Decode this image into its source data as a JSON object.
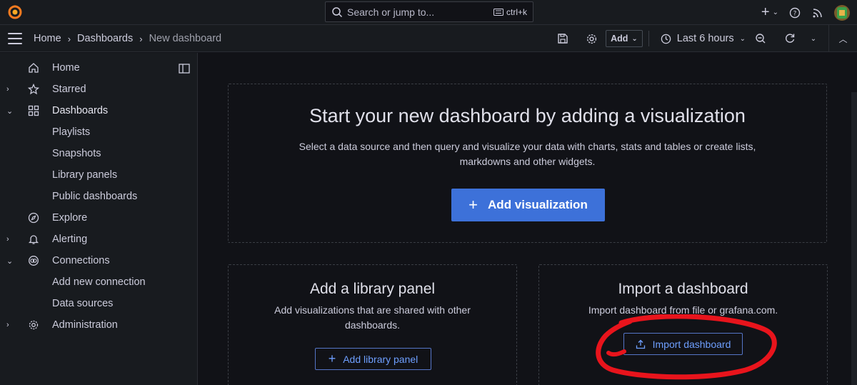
{
  "topbar": {
    "search_placeholder": "Search or jump to...",
    "shortcut": "ctrl+k",
    "icons": [
      "grafana-logo",
      "search-icon",
      "keyboard-icon",
      "plus-icon",
      "help-icon",
      "news-icon",
      "avatar"
    ]
  },
  "breadcrumb": {
    "items": [
      "Home",
      "Dashboards",
      "New dashboard"
    ]
  },
  "toolbar": {
    "add_label": "Add",
    "time_range": "Last 6 hours",
    "icons": [
      "save-icon",
      "settings-icon",
      "clock-icon",
      "zoom-out-icon",
      "refresh-icon",
      "collapse-icon"
    ]
  },
  "sidebar": {
    "items": [
      {
        "label": "Home",
        "icon": "home-icon",
        "caret": ""
      },
      {
        "label": "Starred",
        "icon": "star-icon",
        "caret": "›"
      },
      {
        "label": "Dashboards",
        "icon": "apps-icon",
        "caret": "⌄"
      },
      {
        "label": "Playlists",
        "icon": "",
        "caret": ""
      },
      {
        "label": "Snapshots",
        "icon": "",
        "caret": ""
      },
      {
        "label": "Library panels",
        "icon": "",
        "caret": ""
      },
      {
        "label": "Public dashboards",
        "icon": "",
        "caret": ""
      },
      {
        "label": "Explore",
        "icon": "compass-icon",
        "caret": ""
      },
      {
        "label": "Alerting",
        "icon": "bell-icon",
        "caret": "›"
      },
      {
        "label": "Connections",
        "icon": "connections-icon",
        "caret": "⌄"
      },
      {
        "label": "Add new connection",
        "icon": "",
        "caret": ""
      },
      {
        "label": "Data sources",
        "icon": "",
        "caret": ""
      },
      {
        "label": "Administration",
        "icon": "cog-icon",
        "caret": "›"
      }
    ]
  },
  "main": {
    "hero": {
      "title": "Start your new dashboard by adding a visualization",
      "description": "Select a data source and then query and visualize your data with charts, stats and tables or create lists, markdowns and other widgets.",
      "button": "Add visualization"
    },
    "library": {
      "title": "Add a library panel",
      "description": "Add visualizations that are shared with other dashboards.",
      "button": "Add library panel"
    },
    "import": {
      "title": "Import a dashboard",
      "description": "Import dashboard from file or grafana.com.",
      "button": "Import dashboard"
    }
  },
  "colors": {
    "background": "#111217",
    "panel": "#181b1f",
    "primary": "#3d71d9",
    "link": "#6e9fff",
    "annotation": "#e8141c"
  }
}
